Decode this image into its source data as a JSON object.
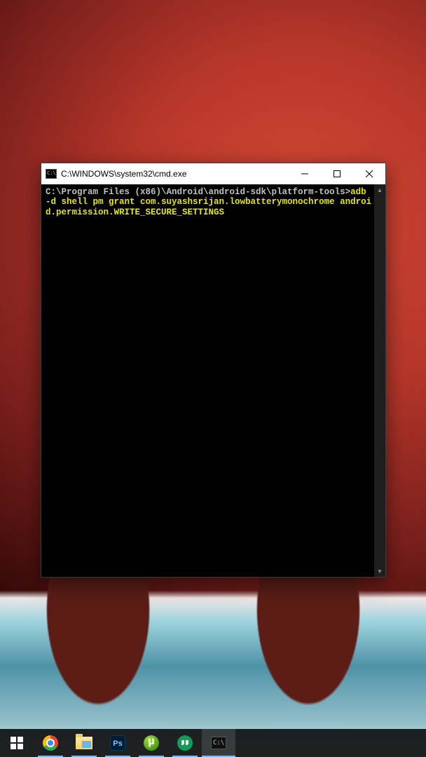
{
  "window": {
    "title": "C:\\WINDOWS\\system32\\cmd.exe",
    "terminal_prompt": "C:\\Program Files (x86)\\Android\\android-sdk\\platform-tools>",
    "terminal_command": "adb -d shell pm grant com.suyashsrijan.lowbatterymonochrome android.permission.WRITE_SECURE_SETTINGS"
  },
  "taskbar": {
    "start": "Start",
    "chrome": "Google Chrome",
    "explorer": "File Explorer",
    "photoshop": "Ps",
    "utorrent": "µTorrent",
    "hangouts": "Hangouts",
    "cmd": "Command Prompt"
  }
}
